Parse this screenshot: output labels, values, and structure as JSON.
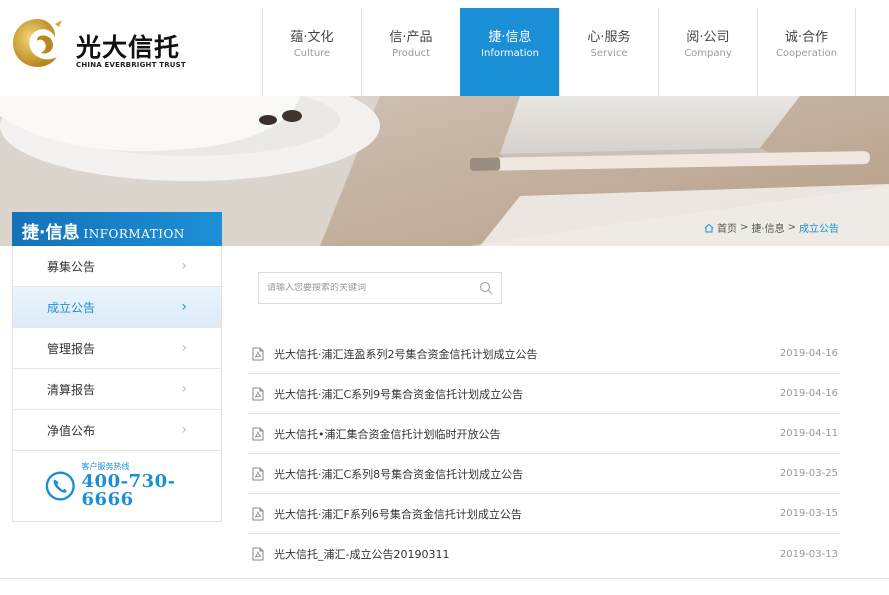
{
  "logo": {
    "cn": "光大信托",
    "en": "CHINA EVERBRIGHT TRUST"
  },
  "nav": [
    {
      "cn": "蕴·文化",
      "en": "Culture"
    },
    {
      "cn": "信·产品",
      "en": "Product"
    },
    {
      "cn": "捷·信息",
      "en": "Information",
      "active": true
    },
    {
      "cn": "心·服务",
      "en": "Service"
    },
    {
      "cn": "阅·公司",
      "en": "Company"
    },
    {
      "cn": "诚·合作",
      "en": "Cooperation"
    }
  ],
  "breadcrumb": {
    "home": "首页",
    "sep": ">",
    "section": "捷·信息",
    "current": "成立公告"
  },
  "sidebar": {
    "title_cn": "捷·信息",
    "title_en": "INFORMATION",
    "items": [
      {
        "label": "募集公告"
      },
      {
        "label": "成立公告",
        "active": true
      },
      {
        "label": "管理报告"
      },
      {
        "label": "清算报告"
      },
      {
        "label": "净值公布"
      }
    ],
    "arrow": "›",
    "hotline_label": "客户服务热线",
    "hotline_number": "400-730-6666"
  },
  "search": {
    "placeholder": "请输入您要搜索的关键词"
  },
  "list": [
    {
      "title": "光大信托·浦汇连盈系列2号集合资金信托计划成立公告",
      "date": "2019-04-16"
    },
    {
      "title": "光大信托·浦汇C系列9号集合资金信托计划成立公告",
      "date": "2019-04-16"
    },
    {
      "title": "光大信托•浦汇集合资金信托计划临时开放公告",
      "date": "2019-04-11"
    },
    {
      "title": "光大信托·浦汇C系列8号集合资金信托计划成立公告",
      "date": "2019-03-25"
    },
    {
      "title": "光大信托·浦汇F系列6号集合资金信托计划成立公告",
      "date": "2019-03-15"
    },
    {
      "title": "光大信托_浦汇-成立公告20190311",
      "date": "2019-03-13"
    }
  ],
  "colors": {
    "accent": "#1a8fd6",
    "logo_gold": "#c9a13b"
  }
}
